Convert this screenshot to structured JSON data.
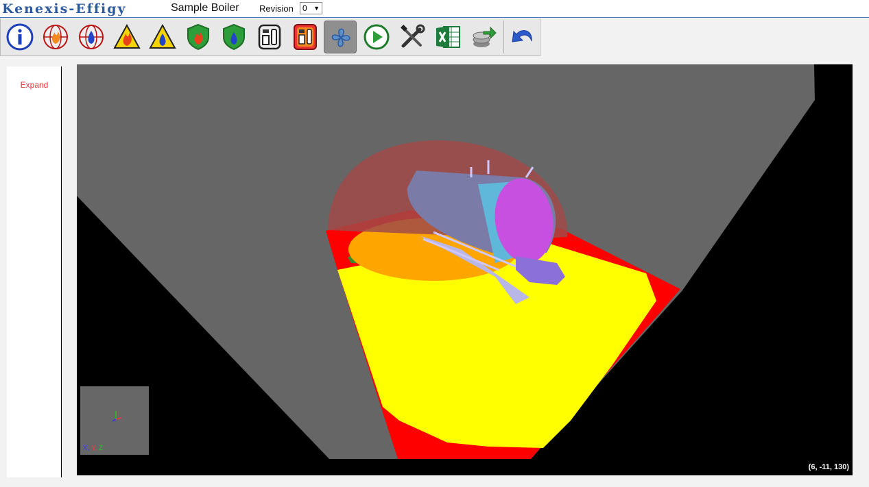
{
  "app": {
    "brand": "Kenexis-Effigy",
    "project": "Sample Boiler",
    "revision_label": "Revision",
    "revision_value": "0"
  },
  "toolbar": {
    "buttons": [
      {
        "name": "info-button",
        "icon": "info-icon"
      },
      {
        "name": "fire-globe-button",
        "icon": "fire-globe-icon"
      },
      {
        "name": "gas-globe-button",
        "icon": "gas-globe-icon"
      },
      {
        "name": "fire-hazard-button",
        "icon": "fire-warning-icon"
      },
      {
        "name": "gas-hazard-button",
        "icon": "gas-warning-icon"
      },
      {
        "name": "fire-shield-button",
        "icon": "fire-shield-icon"
      },
      {
        "name": "gas-shield-button",
        "icon": "gas-shield-icon"
      },
      {
        "name": "detector-button",
        "icon": "detector-icon"
      },
      {
        "name": "detector-alt-button",
        "icon": "detector-alt-icon"
      },
      {
        "name": "view-toggle-button",
        "icon": "propeller-icon",
        "active": true
      },
      {
        "name": "run-button",
        "icon": "play-icon"
      },
      {
        "name": "settings-button",
        "icon": "tools-icon"
      },
      {
        "name": "excel-export-button",
        "icon": "excel-icon"
      },
      {
        "name": "database-export-button",
        "icon": "database-export-icon"
      },
      {
        "name": "undo-button",
        "icon": "undo-icon"
      }
    ]
  },
  "sidebar": {
    "expand_label": "Expand"
  },
  "viewport": {
    "axis_labels": {
      "x": "X,",
      "y": " Y,",
      "z": " Z"
    },
    "coordinates": "(6, -11, 130)",
    "colors": {
      "floor": "#666666",
      "background": "#000000",
      "coverage_high": "#ffff00",
      "coverage_mid": "#ffa500",
      "coverage_none": "#ff0000",
      "dome": "#a04a48"
    }
  }
}
